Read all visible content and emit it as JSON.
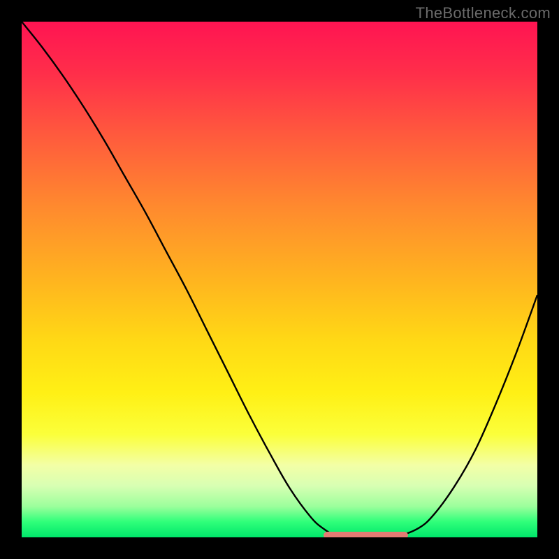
{
  "watermark": "TheBottleneck.com",
  "colors": {
    "curve_stroke": "#000000",
    "marker_fill": "#e27b73",
    "frame": "#000000"
  },
  "chart_data": {
    "type": "line",
    "title": "",
    "xlabel": "",
    "ylabel": "",
    "xlim": [
      0,
      100
    ],
    "ylim": [
      0,
      100
    ],
    "grid": false,
    "series": [
      {
        "name": "curve",
        "x": [
          0,
          4,
          8,
          12,
          16,
          20,
          24,
          28,
          32,
          36,
          40,
          44,
          48,
          52,
          56,
          58.5,
          61,
          65,
          69,
          73,
          77,
          80,
          84,
          88,
          92,
          96,
          100
        ],
        "y": [
          100,
          95,
          89.5,
          83.5,
          77,
          70,
          63,
          55.5,
          48,
          40,
          32,
          24,
          16.5,
          9.5,
          4,
          1.7,
          0.4,
          0.2,
          0.2,
          0.3,
          1.8,
          4.5,
          10,
          17,
          26,
          36,
          47
        ]
      }
    ],
    "annotations": [
      {
        "name": "marker",
        "x_start": 58.5,
        "x_end": 75,
        "y": 0.4
      }
    ]
  }
}
